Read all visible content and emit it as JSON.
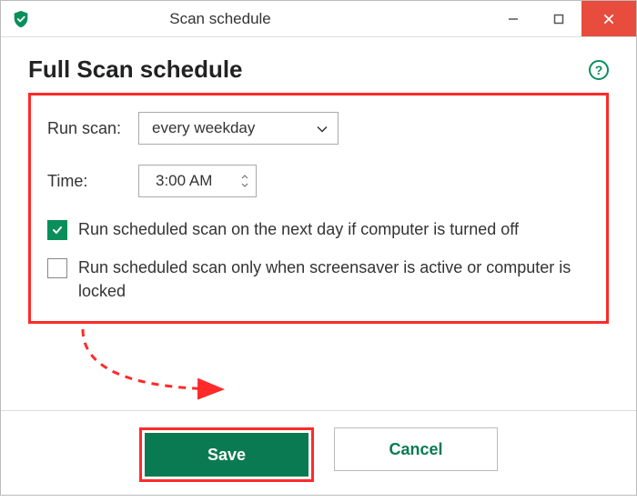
{
  "window": {
    "title": "Scan schedule"
  },
  "heading": "Full Scan schedule",
  "form": {
    "run_scan_label": "Run scan:",
    "run_scan_value": "every weekday",
    "time_label": "Time:",
    "time_value": "3:00 AM"
  },
  "checkboxes": {
    "next_day": {
      "checked": true,
      "label": "Run scheduled scan on the next day if computer is turned off"
    },
    "screensaver": {
      "checked": false,
      "label": "Run scheduled scan only when screensaver is active or computer is locked"
    }
  },
  "buttons": {
    "save": "Save",
    "cancel": "Cancel"
  },
  "icons": {
    "help": "?",
    "check": "✓"
  },
  "colors": {
    "accent": "#0a7a53",
    "highlight": "#ff2a2a"
  }
}
